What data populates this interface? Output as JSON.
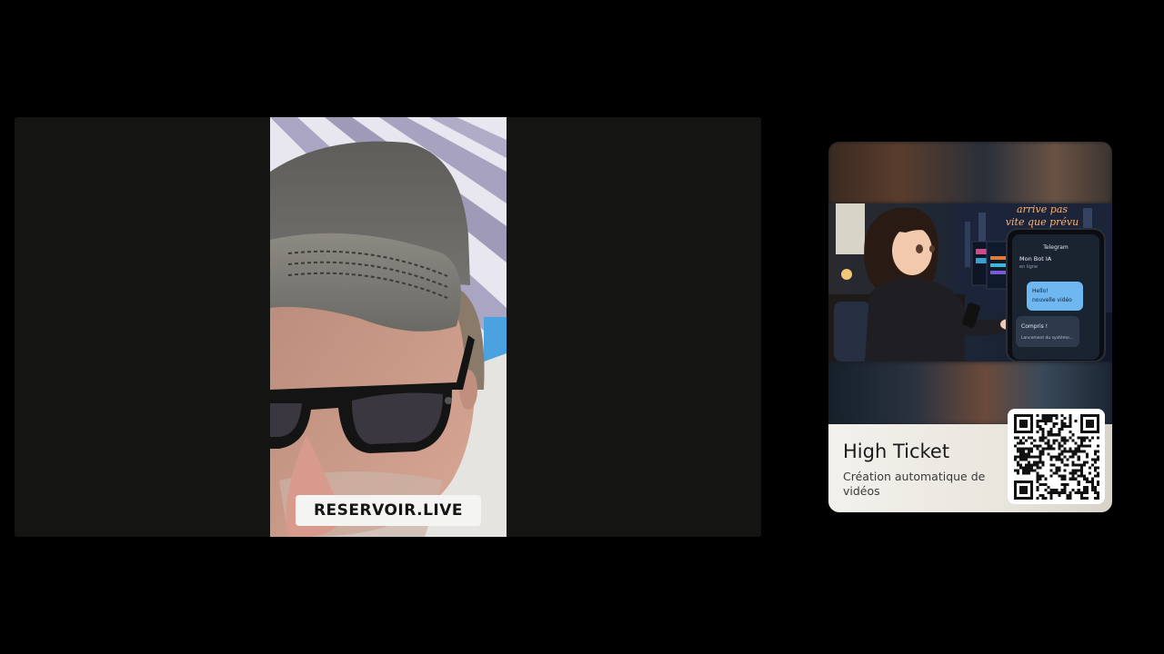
{
  "video": {
    "watermark_text": "RESERVOIR.LIVE"
  },
  "promo": {
    "title": "High Ticket",
    "subtitle": "Création automatique de vidéos",
    "image_signs": {
      "neon_line1": "arrive pas",
      "neon_line2": "vite que prévu"
    },
    "phone_chat": {
      "app": "Telegram",
      "contact": "Mon Bot IA",
      "status": "en ligne",
      "message_out_1": "Hello!",
      "message_out_2": "nouvelle vidéo",
      "message_in_1": "Compris !",
      "message_in_2": "Lancement du système..."
    }
  },
  "colors": {
    "page_background": "#000000",
    "player_background": "#141412",
    "card_footer": "#f3f1ec",
    "neon": "#ffb070",
    "chat_bubble": "#6fb7f0"
  }
}
